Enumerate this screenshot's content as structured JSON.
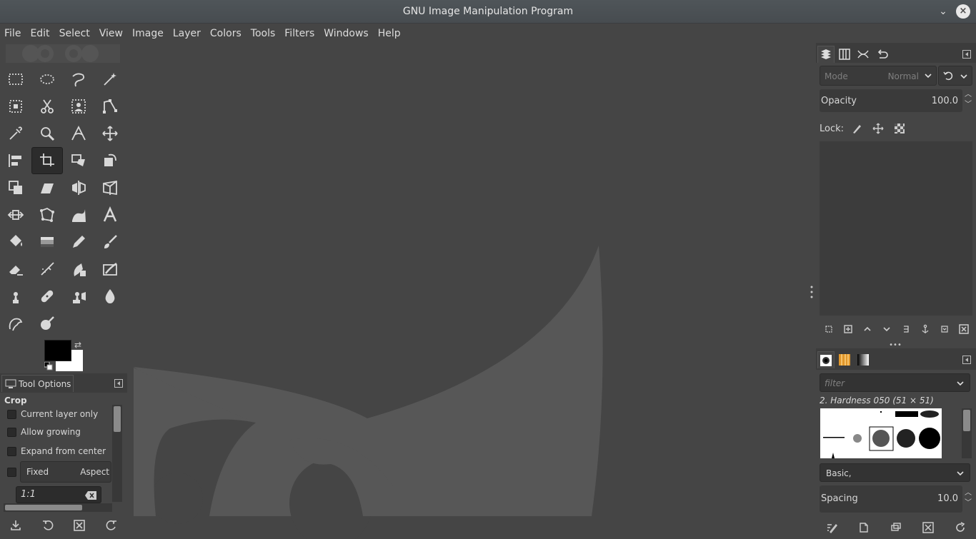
{
  "window": {
    "title": "GNU Image Manipulation Program"
  },
  "menubar": {
    "items": [
      "File",
      "Edit",
      "Select",
      "View",
      "Image",
      "Layer",
      "Colors",
      "Tools",
      "Filters",
      "Windows",
      "Help"
    ]
  },
  "toolbox": {
    "active_tool": "crop-tool",
    "tools": [
      "rect-select-tool",
      "ellipse-select-tool",
      "free-select-tool",
      "fuzzy-select-tool",
      "select-by-color-tool",
      "scissors-select-tool",
      "foreground-select-tool",
      "paths-tool",
      "color-picker-tool",
      "zoom-tool",
      "measure-tool",
      "move-tool",
      "align-tool",
      "crop-tool",
      "unified-transform-tool",
      "rotate-tool",
      "scale-tool",
      "shear-tool",
      "flip-tool",
      "perspective-tool",
      "handle-transform-tool",
      "cage-transform-tool",
      "warp-transform-tool",
      "text-tool",
      "bucket-fill-tool",
      "gradient-tool",
      "pencil-tool",
      "paintbrush-tool",
      "eraser-tool",
      "airbrush-tool",
      "ink-tool",
      "mypaint-brush-tool",
      "clone-tool",
      "heal-tool",
      "perspective-clone-tool",
      "blur-sharpen-tool",
      "smudge-tool",
      "dodge-burn-tool"
    ],
    "foreground_color": "#000000",
    "background_color": "#ffffff"
  },
  "tool_options": {
    "tab_label": "Tool Options",
    "heading": "Crop",
    "options": [
      {
        "label": "Current layer only",
        "checked": false
      },
      {
        "label": "Allow growing",
        "checked": false
      },
      {
        "label": "Expand from center",
        "checked": false
      }
    ],
    "fixed_checked": false,
    "fixed_label": "Fixed",
    "fixed_value": "Aspect",
    "ratio_value": "1:1"
  },
  "layers_dock": {
    "mode_label": "Mode",
    "mode_value": "Normal",
    "opacity_label": "Opacity",
    "opacity_value": "100.0",
    "lock_label": "Lock:"
  },
  "brushes_dock": {
    "filter_placeholder": "filter",
    "brush_name": "2. Hardness 050 (51 × 51)",
    "brush_set": "Basic,",
    "spacing_label": "Spacing",
    "spacing_value": "10.0"
  },
  "colors": {
    "bg": "#454545",
    "panel": "#3c3c3c",
    "text": "#d2d2d2"
  }
}
